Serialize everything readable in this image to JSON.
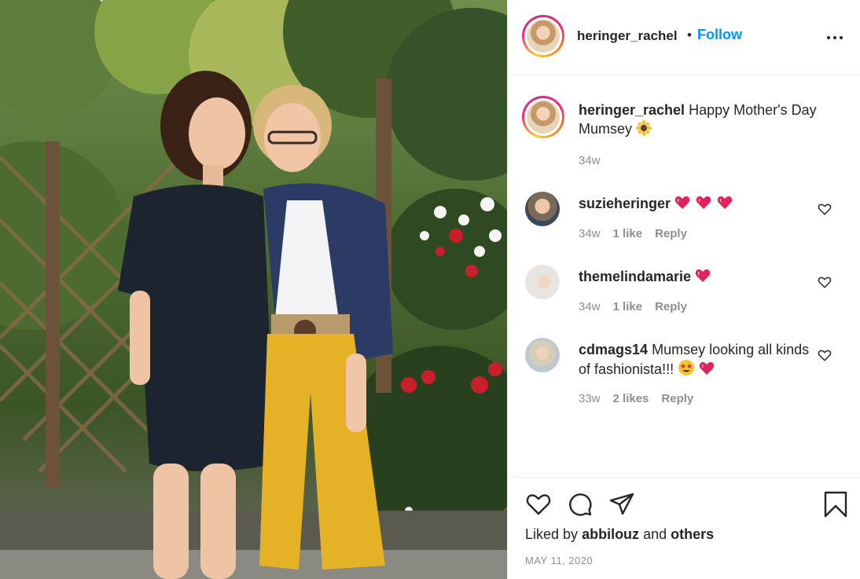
{
  "post": {
    "username": "heringer_rachel",
    "dot": "•",
    "follow_label": "Follow",
    "caption": "Happy Mother's Day Mumsey",
    "caption_time": "34w",
    "likes_prefix": "Liked by",
    "liked_by_user": "abbilouz",
    "likes_and": "and",
    "likes_others": "others",
    "date": "MAY 11, 2020"
  },
  "comments": [
    {
      "username": "suzieheringer",
      "text": "",
      "time": "34w",
      "likes": "1 like",
      "reply": "Reply"
    },
    {
      "username": "themelindamarie",
      "text": "",
      "time": "34w",
      "likes": "1 like",
      "reply": "Reply"
    },
    {
      "username": "cdmags14",
      "text": "Mumsey looking all kinds of fashionista!!!",
      "time": "33w",
      "likes": "2 likes",
      "reply": "Reply"
    }
  ],
  "icons": {
    "more": "more-options-icon",
    "like": "heart-icon",
    "comment": "comment-icon",
    "share": "paper-plane-icon",
    "save": "bookmark-icon",
    "sunflower": "sunflower-emoji",
    "red_heart": "red-heart-emoji",
    "star_eyes": "star-struck-emoji"
  },
  "colors": {
    "link_blue": "#0095f6",
    "text": "#262626",
    "muted": "#8e8e8e",
    "divider": "#efefef",
    "emoji_heart": "#e0245e"
  }
}
